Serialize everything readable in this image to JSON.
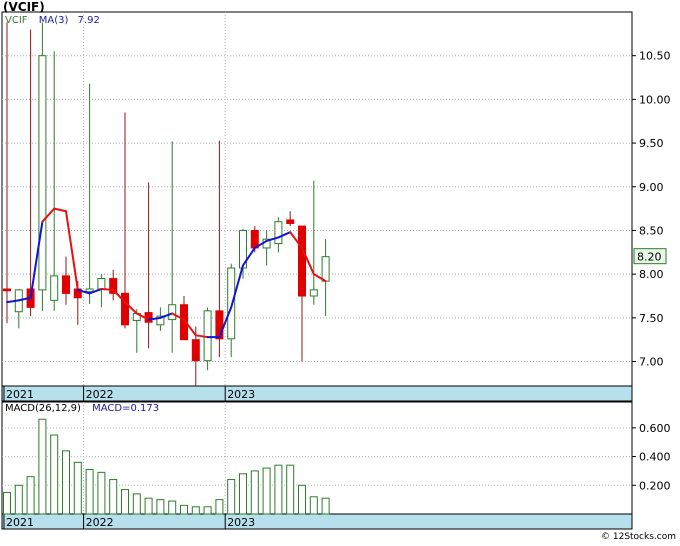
{
  "ticker_title": "(VCIF)",
  "legend": {
    "symbol": "VCIF",
    "ma_label": "MA(3)",
    "ma_value": "7.92",
    "macd_params": "MACD(26,12,9)",
    "macd_value": "MACD=0.173"
  },
  "last_price_label": "8.20",
  "credit": "© 12Stocks.com",
  "colors": {
    "up": "#2e7d2e",
    "down": "#e00000",
    "wick_down": "#8b1a1a",
    "ma_up": "#1414d2",
    "ma_down": "#e81010",
    "axis_band": "#b6e0ec",
    "grid": "#b0b0b0",
    "macd_bar": "#2e7d2e"
  },
  "chart_data": [
    {
      "type": "candlestick",
      "ylim": [
        6.72,
        11.0
      ],
      "y_ticks": [
        7.0,
        7.5,
        8.0,
        8.5,
        9.0,
        9.5,
        10.0,
        10.5
      ],
      "y_tick_labels": [
        "7.00",
        "7.50",
        "8.00",
        "8.50",
        "9.00",
        "9.50",
        "10.00",
        "10.50"
      ],
      "x_labels": [
        "2021",
        "2022",
        "2023"
      ],
      "x_label_index": [
        0,
        7,
        19
      ],
      "grid": true,
      "candles": [
        {
          "o": 7.83,
          "h": 10.88,
          "l": 7.44,
          "c": 7.81
        },
        {
          "o": 7.57,
          "h": 7.83,
          "l": 7.38,
          "c": 7.82
        },
        {
          "o": 7.83,
          "h": 10.8,
          "l": 7.52,
          "c": 7.62
        },
        {
          "o": 7.82,
          "h": 10.88,
          "l": 7.58,
          "c": 10.5
        },
        {
          "o": 7.7,
          "h": 10.55,
          "l": 7.58,
          "c": 7.98
        },
        {
          "o": 7.98,
          "h": 8.2,
          "l": 7.65,
          "c": 7.78
        },
        {
          "o": 7.83,
          "h": 7.92,
          "l": 7.42,
          "c": 7.73
        },
        {
          "o": 7.8,
          "h": 10.18,
          "l": 7.66,
          "c": 7.83
        },
        {
          "o": 7.83,
          "h": 8.0,
          "l": 7.62,
          "c": 7.95
        },
        {
          "o": 7.95,
          "h": 8.05,
          "l": 7.7,
          "c": 7.78
        },
        {
          "o": 7.78,
          "h": 9.85,
          "l": 7.38,
          "c": 7.42
        },
        {
          "o": 7.47,
          "h": 7.6,
          "l": 7.1,
          "c": 7.55
        },
        {
          "o": 7.56,
          "h": 9.05,
          "l": 7.15,
          "c": 7.45
        },
        {
          "o": 7.42,
          "h": 7.62,
          "l": 7.35,
          "c": 7.52
        },
        {
          "o": 7.48,
          "h": 9.52,
          "l": 7.1,
          "c": 7.65
        },
        {
          "o": 7.65,
          "h": 7.75,
          "l": 7.3,
          "c": 7.25
        },
        {
          "o": 7.25,
          "h": 7.4,
          "l": 6.72,
          "c": 7.01
        },
        {
          "o": 7.01,
          "h": 7.62,
          "l": 6.9,
          "c": 7.58
        },
        {
          "o": 7.58,
          "h": 9.53,
          "l": 7.05,
          "c": 7.26
        },
        {
          "o": 7.26,
          "h": 8.12,
          "l": 7.05,
          "c": 8.07
        },
        {
          "o": 8.07,
          "h": 8.52,
          "l": 7.95,
          "c": 8.5
        },
        {
          "o": 8.5,
          "h": 8.55,
          "l": 8.25,
          "c": 8.3
        },
        {
          "o": 8.3,
          "h": 8.5,
          "l": 8.1,
          "c": 8.4
        },
        {
          "o": 8.35,
          "h": 8.65,
          "l": 8.25,
          "c": 8.6
        },
        {
          "o": 8.62,
          "h": 8.72,
          "l": 8.55,
          "c": 8.58
        },
        {
          "o": 8.55,
          "h": 8.55,
          "l": 7.0,
          "c": 7.75
        },
        {
          "o": 7.75,
          "h": 9.07,
          "l": 7.65,
          "c": 7.82
        },
        {
          "o": 7.92,
          "h": 8.4,
          "l": 7.52,
          "c": 8.2
        }
      ],
      "ma_values": [
        7.68,
        7.7,
        7.73,
        8.6,
        8.75,
        8.72,
        7.82,
        7.78,
        7.83,
        7.82,
        7.68,
        7.55,
        7.48,
        7.5,
        7.55,
        7.48,
        7.3,
        7.28,
        7.28,
        7.62,
        8.1,
        8.3,
        8.38,
        8.42,
        8.48,
        8.3,
        8.0,
        7.92
      ],
      "ma_direction": [
        "up",
        "up",
        "up",
        "up",
        "down",
        "down",
        "down",
        "up",
        "up",
        "down",
        "down",
        "down",
        "down",
        "up",
        "up",
        "down",
        "down",
        "down",
        "up",
        "up",
        "up",
        "up",
        "up",
        "up",
        "up",
        "down",
        "down",
        "down"
      ]
    },
    {
      "type": "bar",
      "title": "MACD(26,12,9)",
      "ylim": [
        0.0,
        0.78
      ],
      "y_ticks": [
        0.2,
        0.4,
        0.6
      ],
      "y_tick_labels": [
        "0.200",
        "0.400",
        "0.600"
      ],
      "x_labels": [
        "2021",
        "2022",
        "2023"
      ],
      "x_label_index": [
        0,
        7,
        19
      ],
      "values": [
        0.15,
        0.2,
        0.26,
        0.66,
        0.55,
        0.44,
        0.36,
        0.31,
        0.29,
        0.24,
        0.17,
        0.14,
        0.11,
        0.1,
        0.09,
        0.06,
        0.05,
        0.05,
        0.1,
        0.24,
        0.28,
        0.3,
        0.32,
        0.34,
        0.34,
        0.2,
        0.12,
        0.11
      ]
    }
  ]
}
